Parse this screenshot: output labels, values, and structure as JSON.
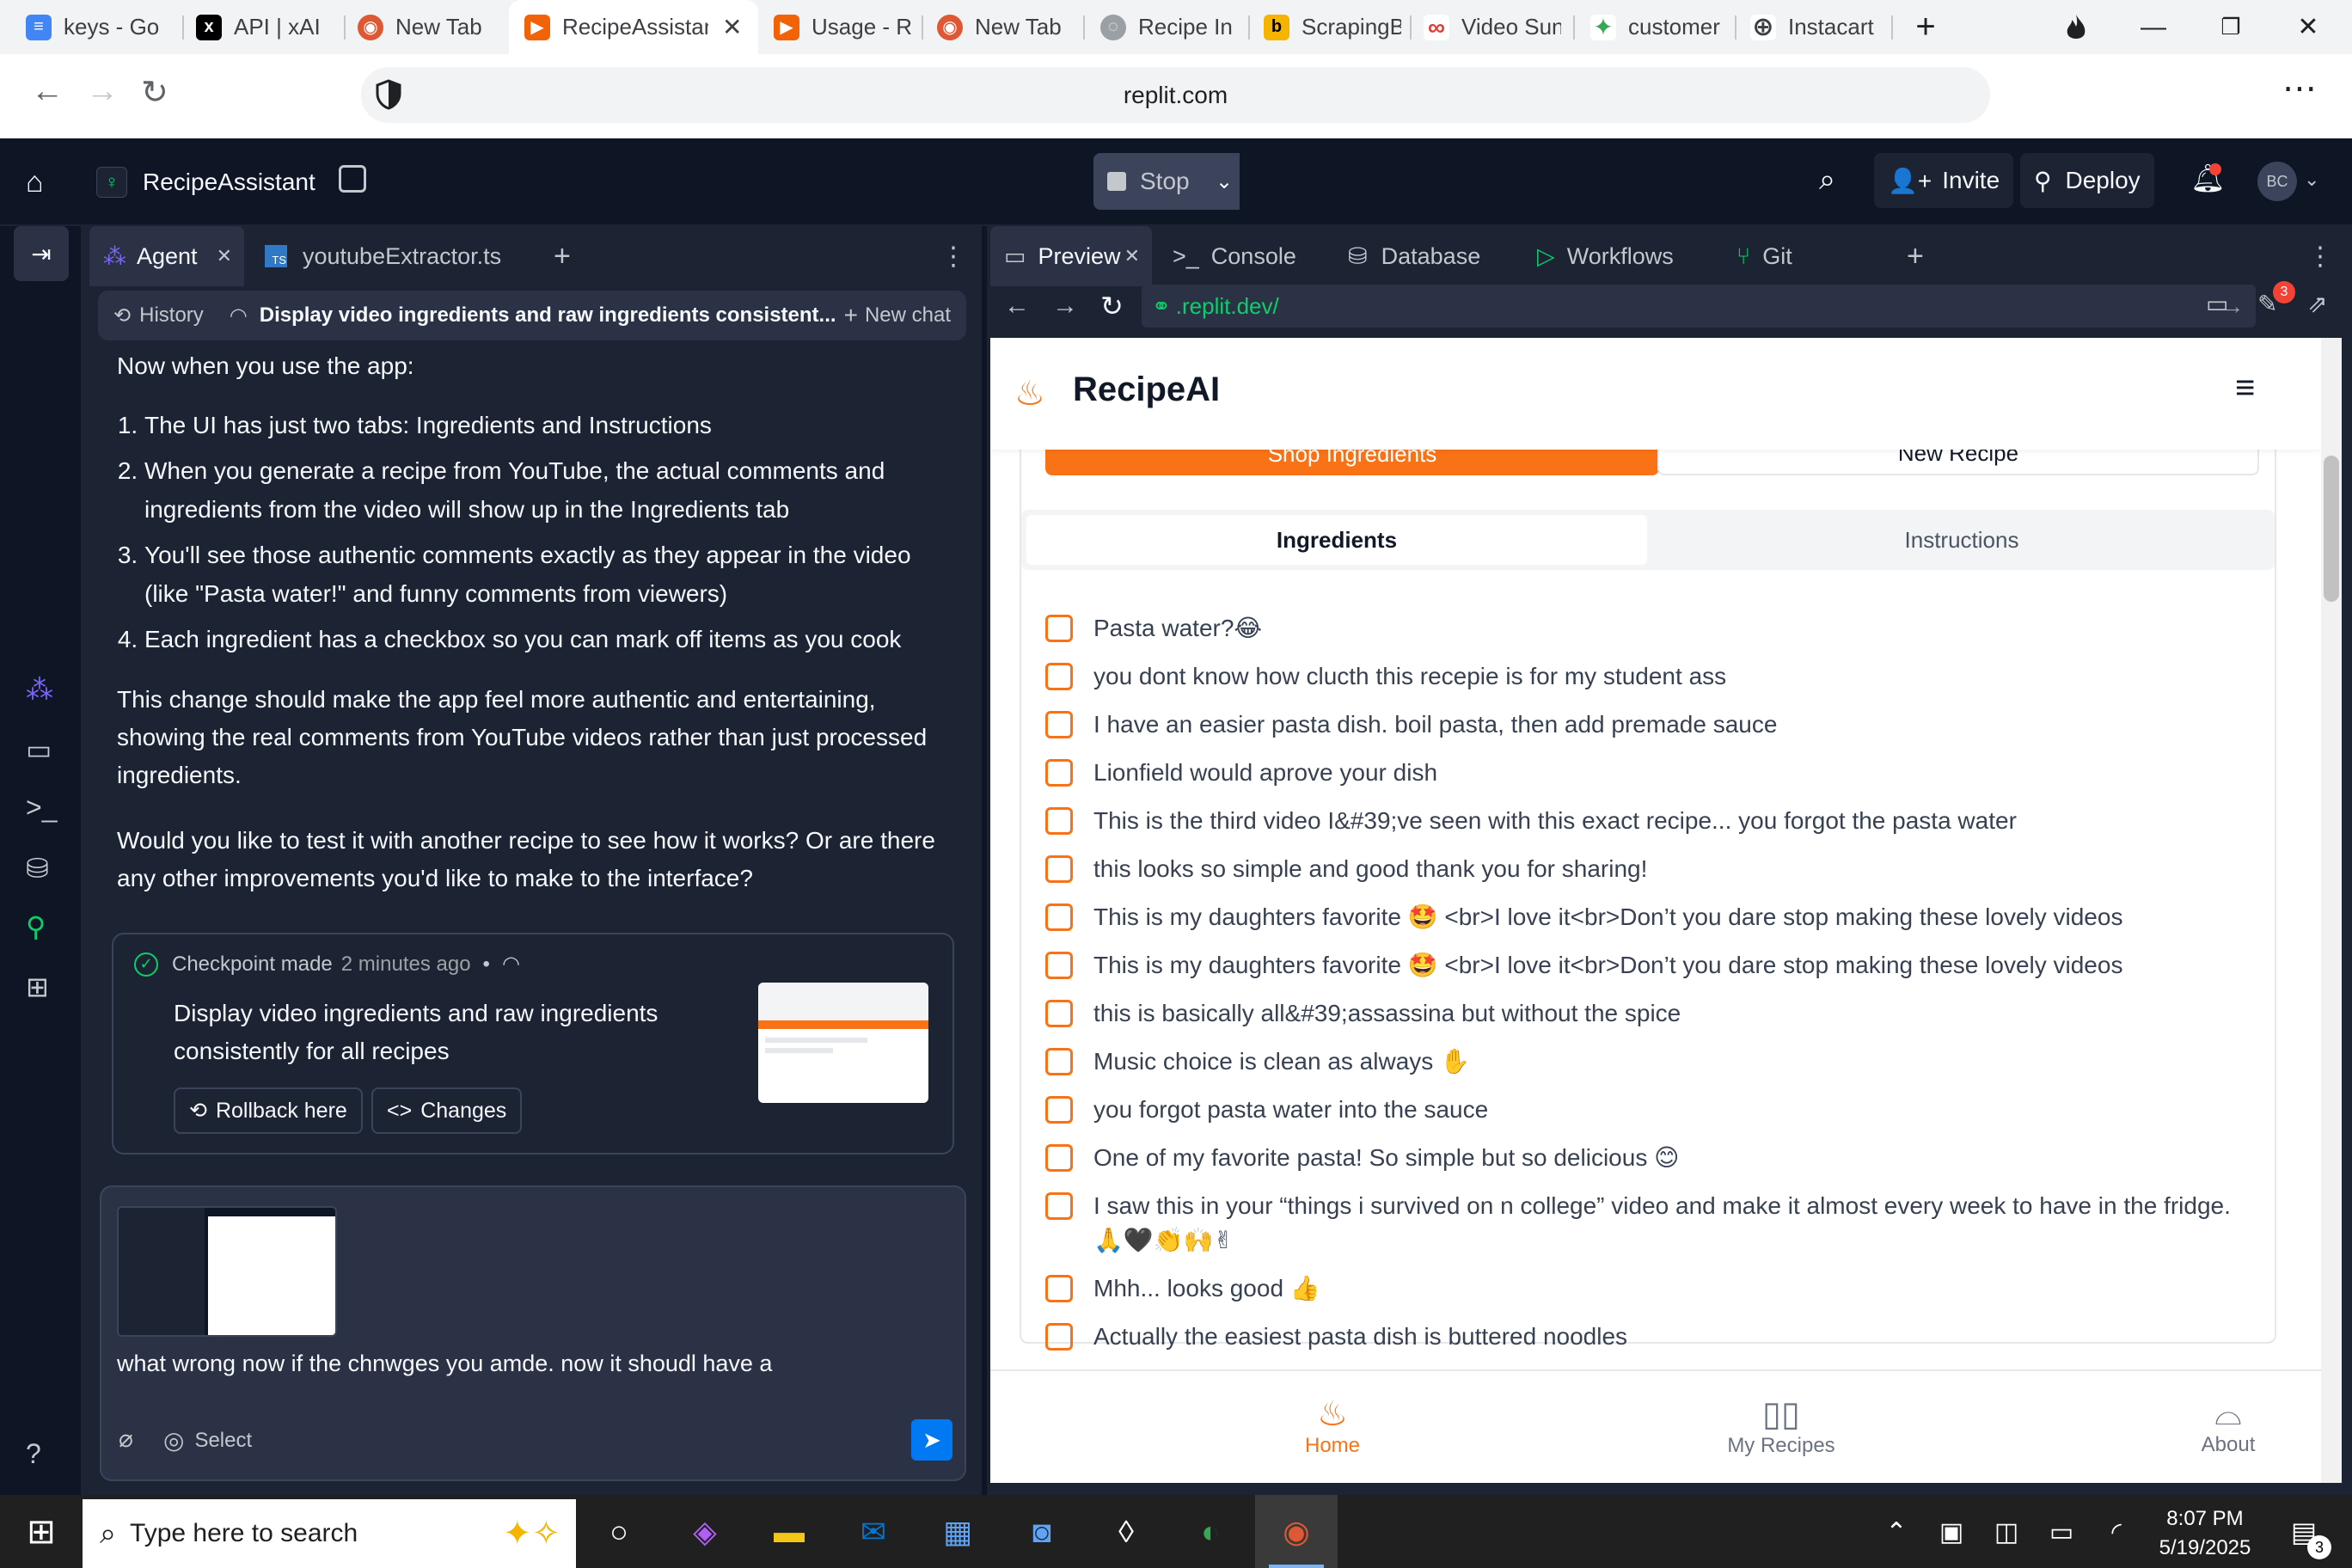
{
  "browser": {
    "tabs": [
      {
        "label": "keys - Go",
        "fav": "≡",
        "color": "#4285f4"
      },
      {
        "label": "API | xAI",
        "fav": "x",
        "color": "#000000"
      },
      {
        "label": "New Tab",
        "fav": "◉",
        "color": "#de5833"
      },
      {
        "label": "RecipeAssistant",
        "fav": "▶",
        "color": "#f26207"
      },
      {
        "label": "Usage - R",
        "fav": "▶",
        "color": "#f26207"
      },
      {
        "label": "New Tab",
        "fav": "◉",
        "color": "#de5833"
      },
      {
        "label": "Recipe In",
        "fav": "◌",
        "color": "#9aa0a6"
      },
      {
        "label": "ScrapingB",
        "fav": "b",
        "color": "#f5b400"
      },
      {
        "label": "Video Sun",
        "fav": "∞",
        "color": "#e53935"
      },
      {
        "label": "customer",
        "fav": "✦",
        "color": "#34a853"
      },
      {
        "label": "Instacart",
        "fav": "⊕",
        "color": "#5f6368"
      }
    ],
    "url": "replit.com"
  },
  "replit": {
    "project": "RecipeAssistant",
    "stop_label": "Stop",
    "invite_label": "Invite",
    "deploy_label": "Deploy",
    "avatar": "BC",
    "left_tabs": {
      "agent": "Agent",
      "file": "youtubeExtractor.ts"
    },
    "right_tabs": {
      "preview": "Preview",
      "console": "Console",
      "database": "Database",
      "workflows": "Workflows",
      "git": "Git"
    },
    "preview_url": ".replit.dev/",
    "badge_count": "3"
  },
  "agent": {
    "history_label": "History",
    "chat_title": "Display video ingredients and raw ingredients consistent...",
    "new_chat_label": "New chat",
    "intro": "Now when you use the app:",
    "list": [
      "The UI has just two tabs: Ingredients and Instructions",
      "When you generate a recipe from YouTube, the actual comments and ingredients from the video will show up in the Ingredients tab",
      "You'll see those authentic comments exactly as they appear in the video (like \"Pasta water!\" and funny comments from viewers)",
      "Each ingredient has a checkbox so you can mark off items as you cook"
    ],
    "para1": "This change should make the app feel more authentic and entertaining, showing the real comments from YouTube videos rather than just processed ingredients.",
    "para2": "Would you like to test it with another recipe to see how it works? Or are there any other improvements you'd like to make to the interface?",
    "checkpoint": {
      "label": "Checkpoint made",
      "time": "2 minutes ago",
      "title": "Display video ingredients and raw ingredients consistently for all recipes",
      "rollback": "Rollback here",
      "changes": "Changes"
    },
    "input_text": "what wrong now if the chnwges you amde. now it shoudl have a",
    "select_label": "Select"
  },
  "app": {
    "name": "RecipeAI",
    "shop_label": "Shop Ingredients",
    "new_recipe_label": "New Recipe",
    "tabs": {
      "ingredients": "Ingredients",
      "instructions": "Instructions"
    },
    "ingredients": [
      "Pasta water?😂",
      "you dont know how clucth this recepie is for my student ass",
      "I have an easier pasta dish. boil pasta, then add premade sauce",
      "Lionfield would aprove your dish",
      "This is the third video I&#39;ve seen with this exact recipe... you forgot the pasta water",
      "this looks so simple and good thank you for sharing!",
      "This is my daughters favorite 🤩 <br>I love it<br>Don’t you dare stop making these lovely videos",
      "This is my daughters favorite 🤩 <br>I love it<br>Don’t you dare stop making these lovely videos",
      "this is basically all&#39;assassina but without the spice",
      "Music choice is clean as always ✋",
      "you forgot pasta water into the sauce",
      "One of my favorite pasta! So simple but so delicious 😊",
      "I saw this in your “things i survived on n college” video and make it almost every week to have in the fridge. 🙏🖤👏🙌✌",
      "Mhh... looks good 👍",
      "Actually the easiest pasta dish is buttered noodles"
    ],
    "bottom_nav": {
      "home": "Home",
      "recipes": "My Recipes",
      "about": "About"
    }
  },
  "taskbar": {
    "search_placeholder": "Type here to search",
    "time": "8:07 PM",
    "date": "5/19/2025",
    "notif": "3"
  }
}
